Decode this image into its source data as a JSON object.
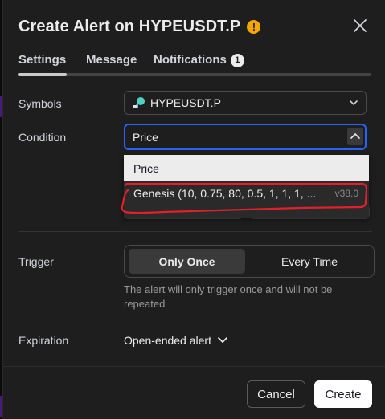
{
  "dialog": {
    "title": "Create Alert on HYPEUSDT.P",
    "warning_glyph": "!"
  },
  "tabs": [
    {
      "label": "Settings",
      "active": true
    },
    {
      "label": "Message",
      "active": false
    },
    {
      "label": "Notifications",
      "badge": "1",
      "active": false
    }
  ],
  "symbols": {
    "label": "Symbols",
    "value": "HYPEUSDT.P"
  },
  "condition": {
    "label": "Condition",
    "value": "Price",
    "options": [
      {
        "label": "Price",
        "version": ""
      },
      {
        "label": "Genesis (10, 0.75, 80, 0.5, 1, 1, 1, ...",
        "version": "v38.0"
      }
    ]
  },
  "trigger": {
    "label": "Trigger",
    "options": [
      "Only Once",
      "Every Time"
    ],
    "selected": "Only Once",
    "hint": "The alert will only trigger once and will not be repeated"
  },
  "expiration": {
    "label": "Expiration",
    "value": "Open-ended alert"
  },
  "footer": {
    "cancel_label": "Cancel",
    "create_label": "Create"
  },
  "colors": {
    "accent": "#2962ff",
    "warning": "#f7a600",
    "annotation": "#e0202a"
  },
  "icons": {
    "close": "close-icon",
    "chevron": "chevron-down-icon",
    "symbol": "exchange-logo-icon"
  }
}
